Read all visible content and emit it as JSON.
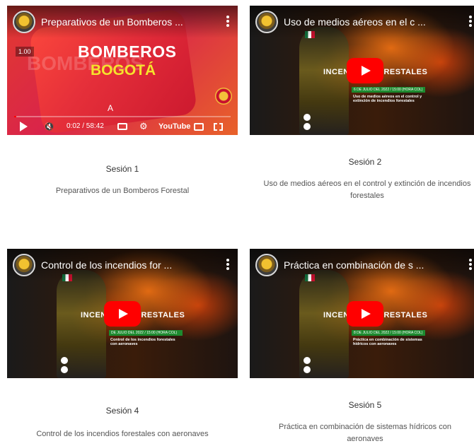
{
  "videos": [
    {
      "title": "Preparativos de un Bomberos Forestal",
      "session": "Sesión 1",
      "description": "Preparativos de un Bomberos Forestal",
      "state": "playing",
      "speed_badge": "1.00",
      "brand_line1": "BOMBEROS",
      "brand_line2": "BOGOTÁ",
      "time": "0:02 / 58:42",
      "progress": 0.01,
      "youtube_label": "YouTube"
    },
    {
      "title": "Uso de medios aéreos en el control y extinción de incendios forestales",
      "session": "Sesión 2",
      "description": "Uso de medios aéreos en el control y extinción de incendios forestales",
      "banner": "INCENDIOS FORESTALES",
      "date_bar": "6 DE JULIO DEL 2022 / 15:00 (HORA COL)"
    },
    {
      "title": "Control de los incendios forestales con aeronaves",
      "session": "Sesión 4",
      "description": "Control de los incendios forestales con aeronaves",
      "banner": "INCENDIOS FORESTALES",
      "date_bar": "DE JULIO DEL 2022 / 15:00 (HORA COL)"
    },
    {
      "title": "Práctica en combinación de sistemas hídricos con aeronaves",
      "session": "Sesión 5",
      "description": "Práctica en combinación de sistemas hídricos con aeronaves",
      "banner": "INCENDIOS FORESTALES",
      "date_bar": "8 DE JULIO DEL 2022 / 15:00 (HORA COL)"
    }
  ],
  "colors": {
    "play_button": "#ff0000",
    "brand_red": "#d9244a",
    "brand_yellow": "#f6e32c"
  },
  "icons": [
    "channel-avatar-icon",
    "more-vert-icon",
    "play-icon",
    "mute-icon",
    "captions-icon",
    "gear-icon",
    "cast-icon",
    "fullscreen-icon"
  ]
}
